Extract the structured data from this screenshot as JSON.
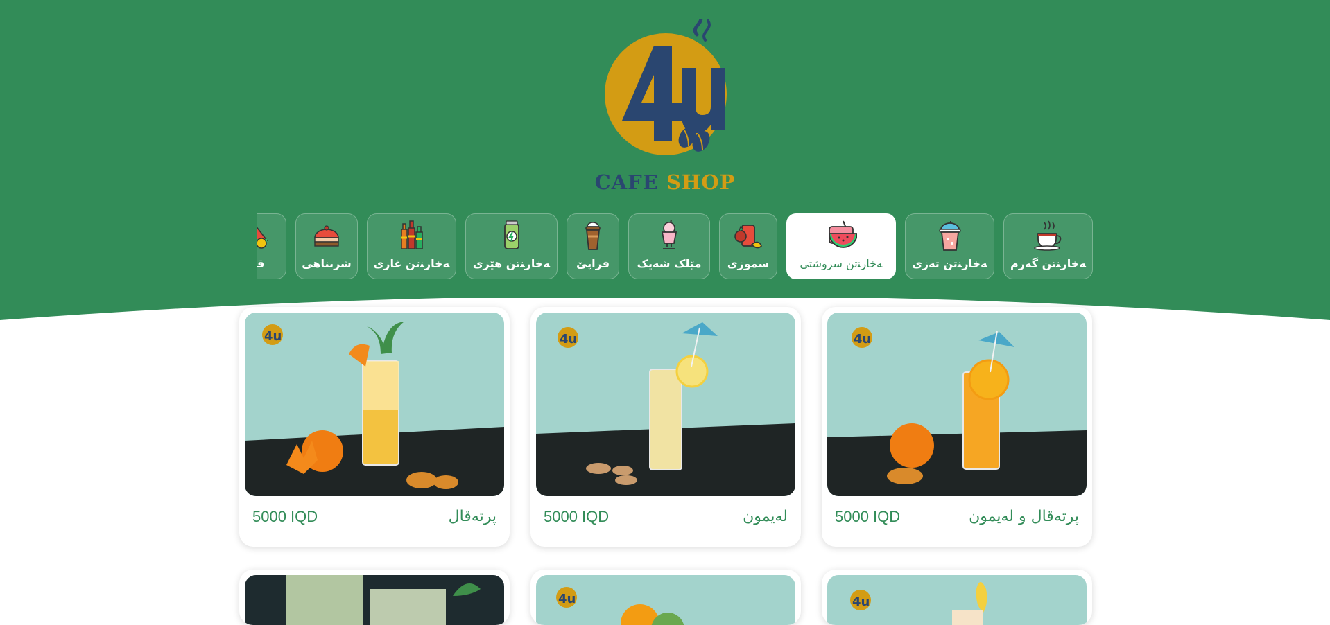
{
  "brand": {
    "word1": "CAFE",
    "word2": "SHOP",
    "logo_text": "4u"
  },
  "colors": {
    "primary": "#328c58",
    "logo_navy": "#2a4670",
    "logo_gold": "#d39c14"
  },
  "categories": [
    {
      "label": "ﻪﺧﺎرﻨﺗﻦ ﮔﻪرم",
      "icon": "hot-drink-icon",
      "active": false
    },
    {
      "label": "ﻪﺧﺎرﻨﺗﻦ ﺗﻪزى",
      "icon": "iced-drink-icon",
      "active": false
    },
    {
      "label": "ﻪﺧﺎرﻨﺗﻦ سروشتى",
      "icon": "watermelon-juice-icon",
      "active": true
    },
    {
      "label": "سموزى",
      "icon": "smoothie-icon",
      "active": false
    },
    {
      "label": "مێلک شەیک",
      "icon": "milkshake-icon",
      "active": false
    },
    {
      "label": "فراپێ",
      "icon": "frappe-icon",
      "active": false
    },
    {
      "label": "ﻪﺧﺎرﻨﺗﻦ هێزى",
      "icon": "energy-drink-icon",
      "active": false
    },
    {
      "label": "ﻪﺧﺎرﻨﺗﻦ غازى",
      "icon": "soda-bottles-icon",
      "active": false
    },
    {
      "label": "شرىناهى",
      "icon": "sweets-icon",
      "active": false
    },
    {
      "label": "قى",
      "icon": "fruit-cocktail-icon",
      "active": false
    }
  ],
  "products": [
    {
      "name": "پرتەقال",
      "price": "5000 IQD"
    },
    {
      "name": "لەیمون",
      "price": "5000 IQD"
    },
    {
      "name": "پرتەقال و لەیمون",
      "price": "5000 IQD"
    }
  ]
}
